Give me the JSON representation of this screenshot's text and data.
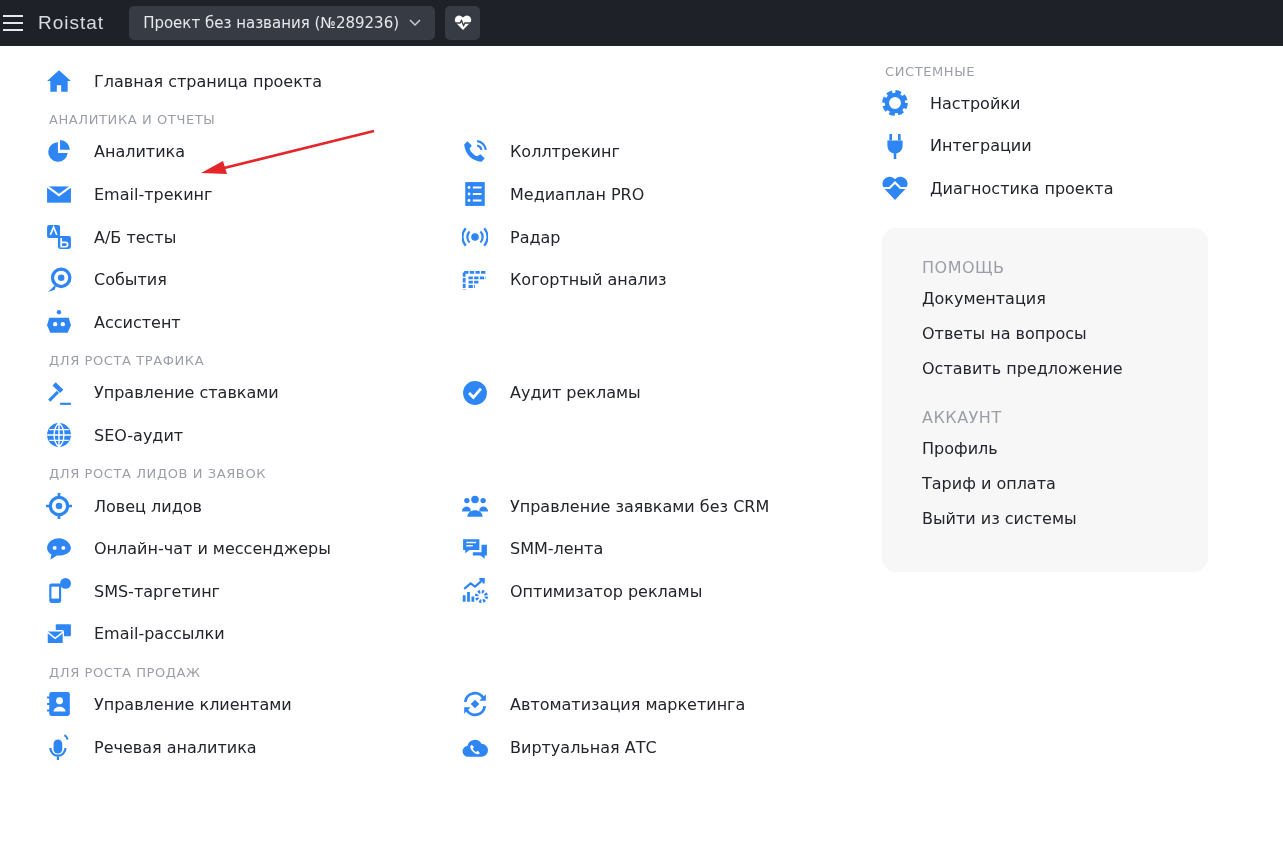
{
  "top_bar": {
    "logo": "Roistat",
    "project_selector": "Проект без названия (№289236)"
  },
  "home_link": "Главная страница проекта",
  "sections": [
    {
      "title": "АНАЛИТИКА И ОТЧЕТЫ",
      "columns": [
        [
          "Аналитика",
          "Email-трекинг",
          "А/Б тесты",
          "События",
          "Ассистент"
        ],
        [
          "Коллтрекинг",
          "Медиаплан PRO",
          "Радар",
          "Когортный анализ"
        ]
      ]
    },
    {
      "title": "ДЛЯ РОСТА ТРАФИКА",
      "columns": [
        [
          "Управление ставками",
          "SEO-аудит"
        ],
        [
          "Аудит рекламы"
        ]
      ]
    },
    {
      "title": "ДЛЯ РОСТА ЛИДОВ И ЗАЯВОК",
      "columns": [
        [
          "Ловец лидов",
          "Онлайн-чат и мессенджеры",
          "SMS-таргетинг",
          "Email-рассылки"
        ],
        [
          "Управление заявками без CRM",
          "SMM-лента",
          "Оптимизатор рекламы"
        ]
      ]
    },
    {
      "title": "ДЛЯ РОСТА ПРОДАЖ",
      "columns": [
        [
          "Управление клиентами",
          "Речевая аналитика"
        ],
        [
          "Автоматизация маркетинга",
          "Виртуальная АТС"
        ]
      ]
    }
  ],
  "system": {
    "title": "СИСТЕМНЫЕ",
    "items": [
      "Настройки",
      "Интеграции",
      "Диагностика проекта"
    ]
  },
  "help_panel": {
    "groups": [
      {
        "title": "ПОМОЩЬ",
        "links": [
          "Документация",
          "Ответы на вопросы",
          "Оставить предложение"
        ]
      },
      {
        "title": "АККАУНТ",
        "links": [
          "Профиль",
          "Тариф и оплата",
          "Выйти из системы"
        ]
      }
    ]
  }
}
